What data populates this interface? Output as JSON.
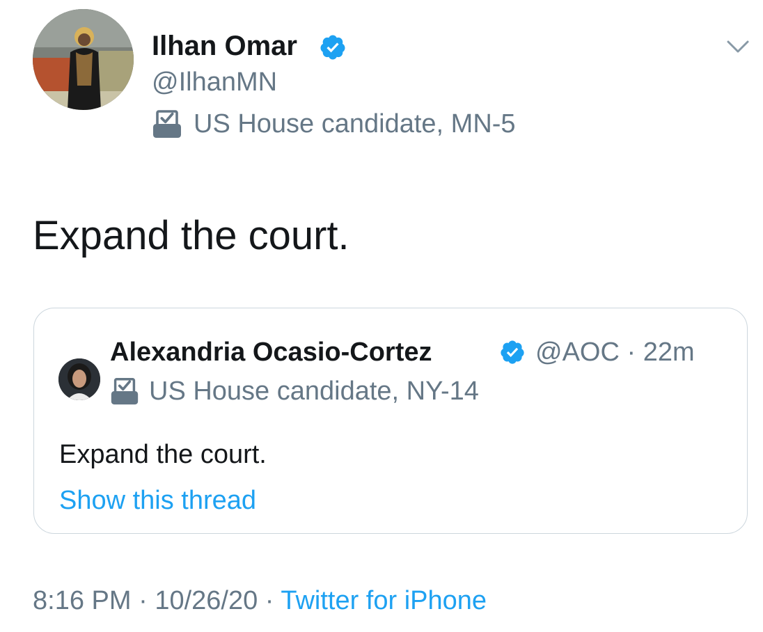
{
  "tweet": {
    "author": {
      "name": "Ilhan Omar",
      "handle": "@IlhanMN",
      "label": "US House candidate, MN-5"
    },
    "text": "Expand the court.",
    "quote": {
      "author_name": "Alexandria Ocasio-Cortez",
      "handle": "@AOC",
      "separator": "·",
      "time": "22m",
      "label": "US House candidate, NY-14",
      "text": "Expand the court.",
      "show_thread": "Show this thread"
    },
    "footer": {
      "time": "8:16 PM",
      "sep1": "·",
      "date": "10/26/20",
      "sep2": "·",
      "source": "Twitter for iPhone"
    }
  },
  "colors": {
    "primary_text": "#14171a",
    "secondary_text": "#657786",
    "link": "#1da1f2",
    "verified": "#1da1f2",
    "border": "#ccd6dd"
  },
  "icons": {
    "verified": "verified-badge-icon",
    "label": "ballot-box-icon",
    "menu": "chevron-down-icon"
  }
}
